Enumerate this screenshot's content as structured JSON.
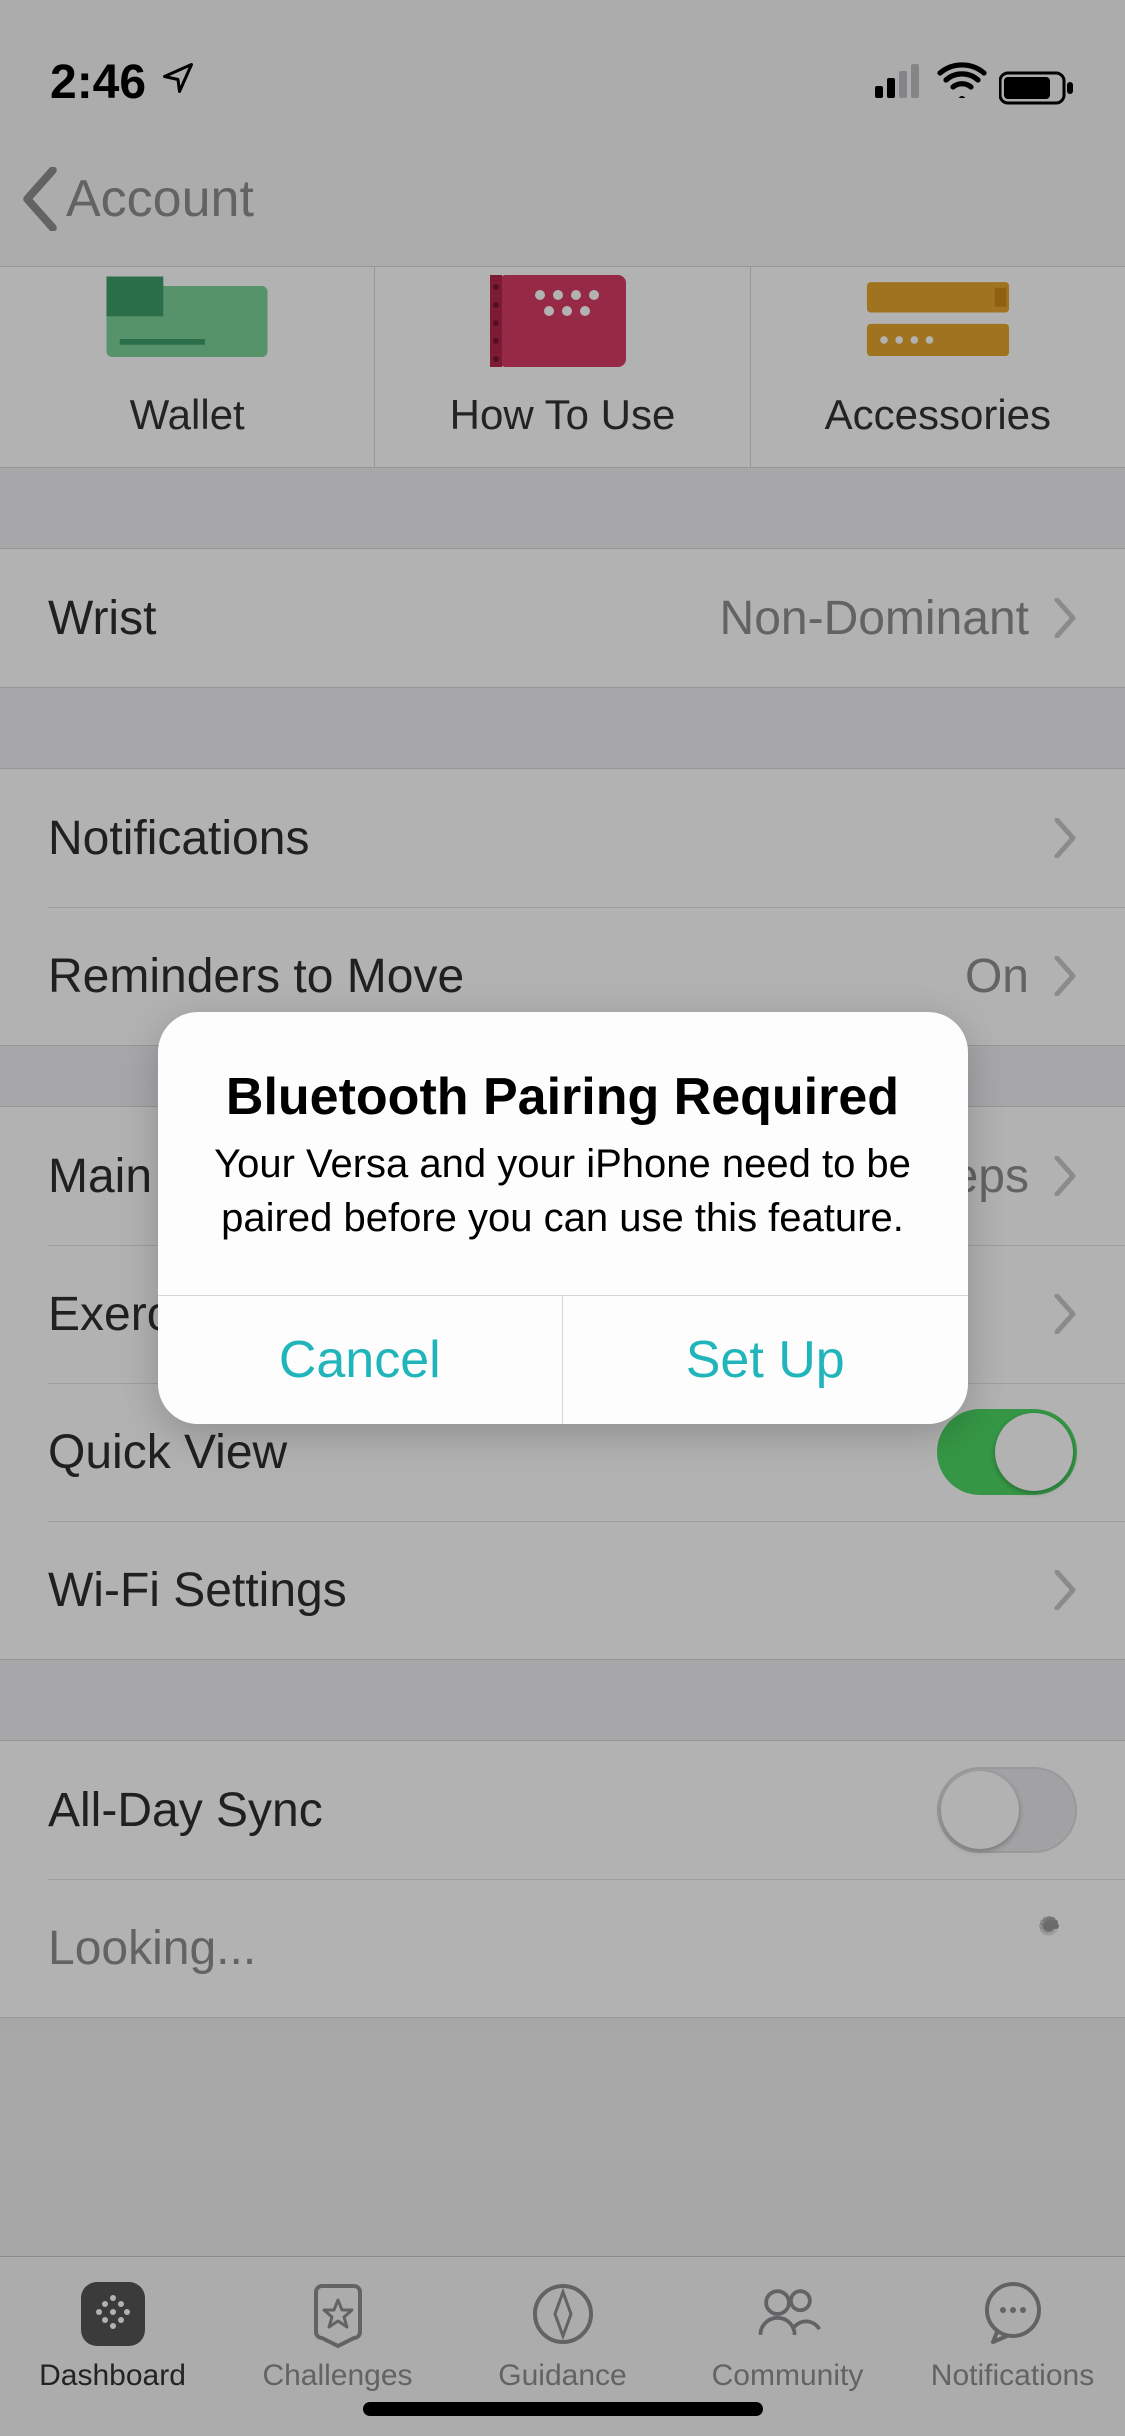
{
  "status_bar": {
    "time": "2:46",
    "location_icon": "location-arrow"
  },
  "nav": {
    "back_label": "Account"
  },
  "tiles": [
    {
      "label": "Wallet"
    },
    {
      "label": "How To Use"
    },
    {
      "label": "Accessories"
    }
  ],
  "settings": {
    "wrist": {
      "label": "Wrist",
      "value": "Non-Dominant"
    },
    "notifications": {
      "label": "Notifications"
    },
    "reminders": {
      "label": "Reminders to Move",
      "value": "On"
    },
    "main_goal": {
      "label": "Main Goal",
      "value": "Steps"
    },
    "exercise_shortcuts": {
      "label": "Exercise Shortcuts"
    },
    "quick_view": {
      "label": "Quick View",
      "on": true
    },
    "wifi": {
      "label": "Wi-Fi Settings"
    },
    "all_day_sync": {
      "label": "All-Day Sync",
      "on": false
    },
    "looking": {
      "label": "Looking..."
    }
  },
  "tab_bar": {
    "items": [
      {
        "label": "Dashboard",
        "active": true
      },
      {
        "label": "Challenges"
      },
      {
        "label": "Guidance"
      },
      {
        "label": "Community"
      },
      {
        "label": "Notifications"
      }
    ]
  },
  "alert": {
    "title": "Bluetooth Pairing Required",
    "message": "Your Versa and your iPhone need to be paired before you can use this feature.",
    "cancel": "Cancel",
    "confirm": "Set Up"
  },
  "colors": {
    "accent": "#1fb5ba",
    "toggle_on": "#4cd964"
  }
}
